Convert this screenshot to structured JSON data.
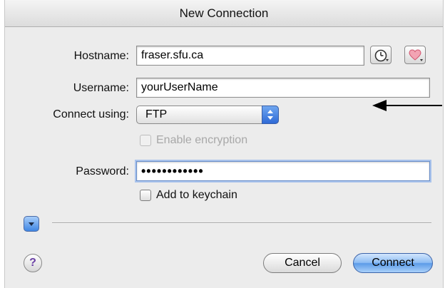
{
  "window": {
    "title": "New Connection"
  },
  "form": {
    "hostname_label": "Hostname:",
    "hostname_value": "fraser.sfu.ca",
    "username_label": "Username:",
    "username_value": "yourUserName",
    "connect_using_label": "Connect using:",
    "connect_using_value": "FTP",
    "enable_encryption_label": "Enable encryption",
    "enable_encryption_checked": false,
    "enable_encryption_enabled": false,
    "password_label": "Password:",
    "password_value": "••••••••••••",
    "add_to_keychain_label": "Add to keychain",
    "add_to_keychain_checked": false
  },
  "icons": {
    "history": "clock-icon",
    "favorites": "heart-icon",
    "disclosure": "triangle-down-icon",
    "help": "question-icon",
    "annotation_arrow": "arrow-left-icon"
  },
  "buttons": {
    "help_label": "?",
    "cancel_label": "Cancel",
    "connect_label": "Connect"
  },
  "colors": {
    "accent_blue": "#5c9be8",
    "heart_red": "#e0637a",
    "help_purple": "#6a3fa5"
  }
}
